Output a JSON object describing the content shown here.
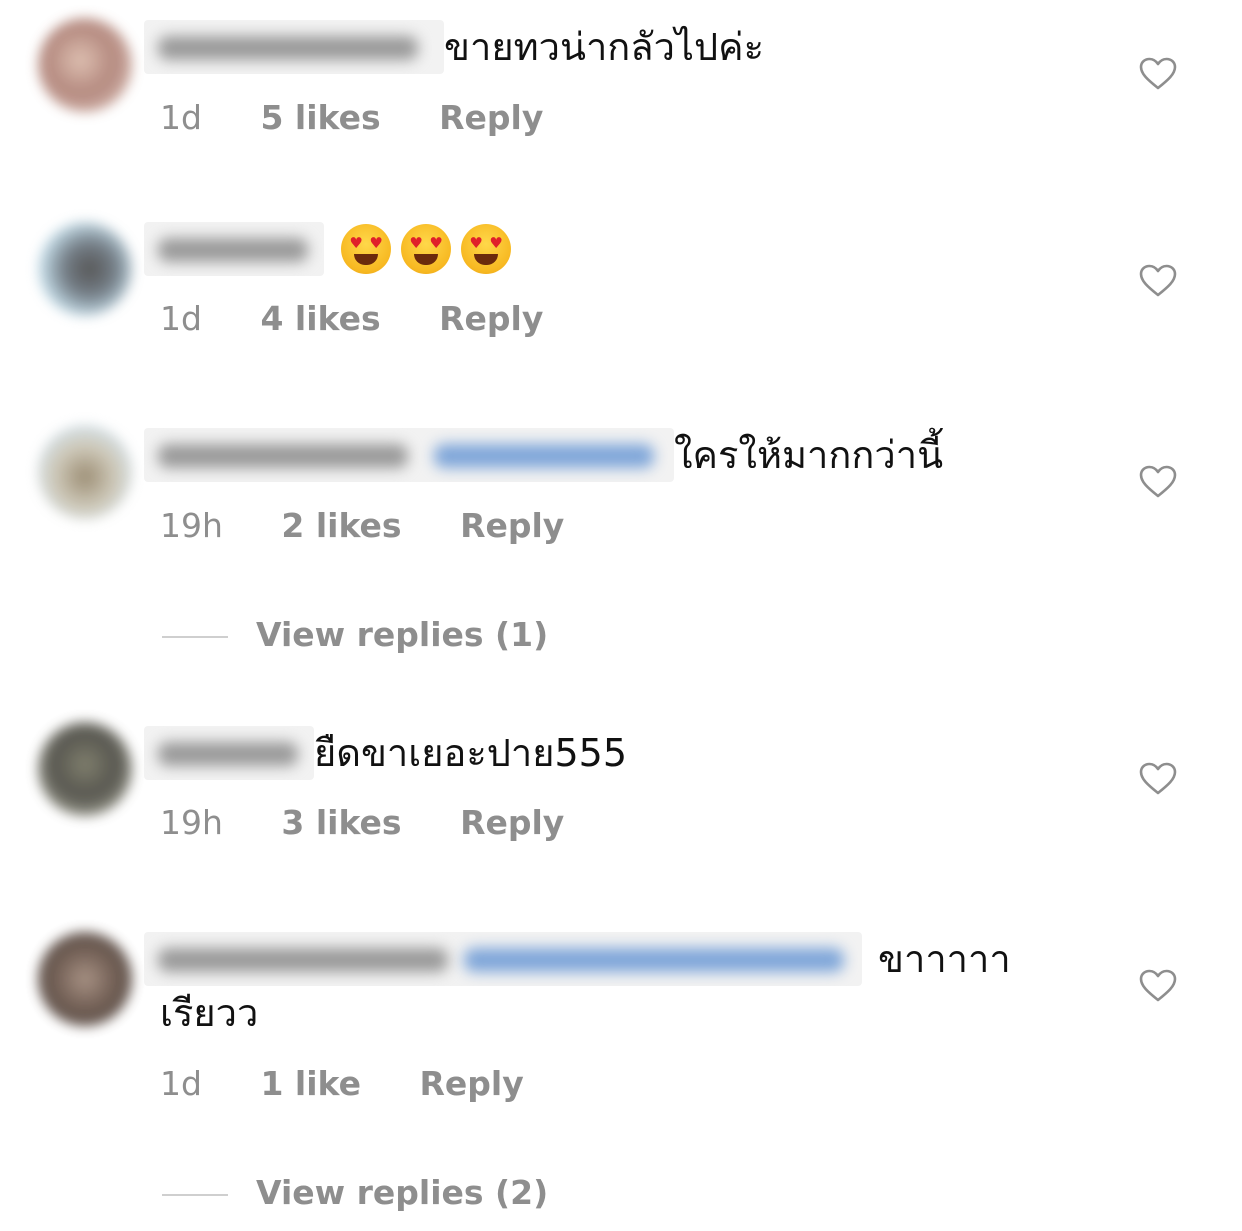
{
  "comments": [
    {
      "text": "ขายทวน่ากลัวไปค่ะ",
      "time": "1d",
      "likes": "5 likes",
      "reply": "Reply",
      "liked": false
    },
    {
      "text": "",
      "emoji_count": 3,
      "emoji": "smiling-face-with-heart-eyes",
      "time": "1d",
      "likes": "4 likes",
      "reply": "Reply",
      "liked": false
    },
    {
      "text": "ใครให้มากกว่านี้",
      "time": "19h",
      "likes": "2 likes",
      "reply": "Reply",
      "liked": false,
      "view_replies": "View replies (1)"
    },
    {
      "text": "ยืดขาเยอะปาย555",
      "time": "19h",
      "likes": "3 likes",
      "reply": "Reply",
      "liked": false
    },
    {
      "text": "ขาาาาา",
      "text_continued": "เรียวว",
      "time": "1d",
      "likes": "1 like",
      "reply": "Reply",
      "liked": false,
      "view_replies": "View replies (2)"
    }
  ],
  "colors": {
    "meta_text": "#8e8e8e",
    "comment_text": "#111111",
    "heart_outline": "#8e8e8e",
    "mention_blur": "#7fa6d9"
  }
}
